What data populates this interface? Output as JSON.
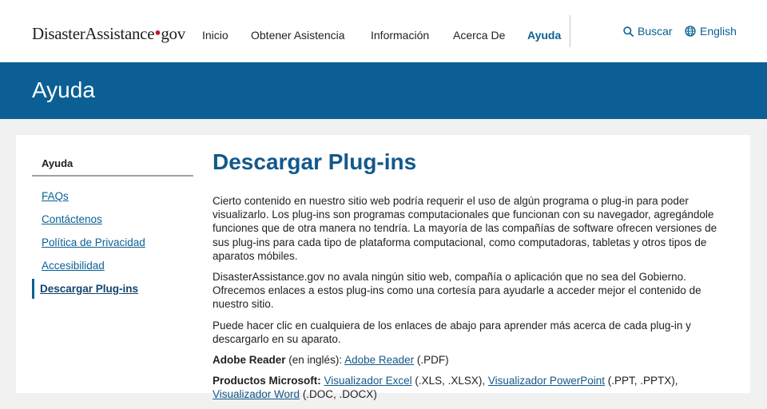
{
  "header": {
    "logo_main": "DisasterAssistance",
    "logo_dot": "•",
    "logo_tld": "gov",
    "nav": [
      "Inicio",
      "Obtener Asistencia",
      "Información",
      "Acerca De",
      "Ayuda"
    ],
    "search_label": "Buscar",
    "language_label": "English"
  },
  "banner": {
    "title": "Ayuda"
  },
  "sidebar": {
    "heading": "Ayuda",
    "items": [
      "FAQs",
      "Contáctenos",
      "Política de Privacidad",
      "Accesibilidad",
      "Descargar Plug-ins"
    ]
  },
  "main": {
    "title": "Descargar Plug-ins",
    "p1": "Cierto contenido en nuestro sitio web podría requerir el uso de algún programa o plug-in para poder visualizarlo. Los plug-ins son programas computacionales que funcionan con su navegador, agregándole funciones que de otra manera no tendría. La mayoría de las compañías de software ofrecen versiones de sus plug-ins para cada tipo de plataforma computacional, como computadoras, tabletas y otros tipos de aparatos móbiles.",
    "p2": "DisasterAssistance.gov no avala ningún sitio web, compañía o aplicación que no sea del Gobierno. Ofrecemos enlaces a estos plug-ins como una cortesía para ayudarle a acceder mejor el contenido de nuestro sitio.",
    "p3": "Puede hacer clic en cualquiera de los enlaces de abajo para aprender más acerca de cada plug-in y descargarlo en su aparato.",
    "adobe": {
      "label": "Adobe Reader",
      "note": " (en inglés):",
      "link": "Adobe Reader",
      "ext": " (.PDF)"
    },
    "ms": {
      "label": "Productos Microsoft:",
      "excel_link": "Visualizador Excel",
      "excel_ext": " (.XLS, .XLSX), ",
      "ppt_link": "Visualizador PowerPoint",
      "ppt_ext": " (.PPT, .PPTX), ",
      "word_link": "Visualizador Word",
      "word_ext": " (.DOC, .DOCX)"
    }
  },
  "colors": {
    "brand_blue": "#0b5f95",
    "logo_red": "#c4182f",
    "page_bg": "#f1f1f1"
  }
}
